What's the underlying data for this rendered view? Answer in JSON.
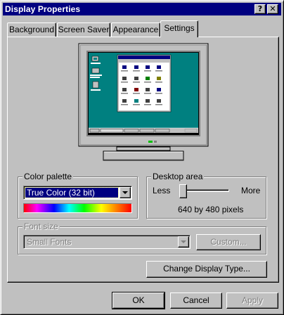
{
  "window": {
    "title": "Display Properties"
  },
  "titlebar": {
    "help_label": "?",
    "close_label": "✕"
  },
  "tabs": [
    {
      "label": "Background"
    },
    {
      "label": "Screen Saver"
    },
    {
      "label": "Appearance"
    },
    {
      "label": "Settings"
    }
  ],
  "active_tab": "Settings",
  "preview": {
    "desktop_color": "#008080",
    "desktop_icons": [
      "My Computer",
      "Network Neighborhood",
      "Recycle Bin"
    ]
  },
  "color_palette": {
    "label": "Color palette",
    "selected": "True Color (32 bit)"
  },
  "desktop_area": {
    "label": "Desktop area",
    "less_label": "Less",
    "more_label": "More",
    "resolution": "640 by 480 pixels",
    "slider_position": 0
  },
  "font_size": {
    "label": "Font size",
    "selected": "Small Fonts",
    "custom_button": "Custom..."
  },
  "buttons": {
    "change_display_type": "Change Display Type...",
    "ok": "OK",
    "cancel": "Cancel",
    "apply": "Apply"
  },
  "colors": {
    "titlebar": "#000080",
    "face": "#c0c0c0",
    "selection": "#000080"
  }
}
